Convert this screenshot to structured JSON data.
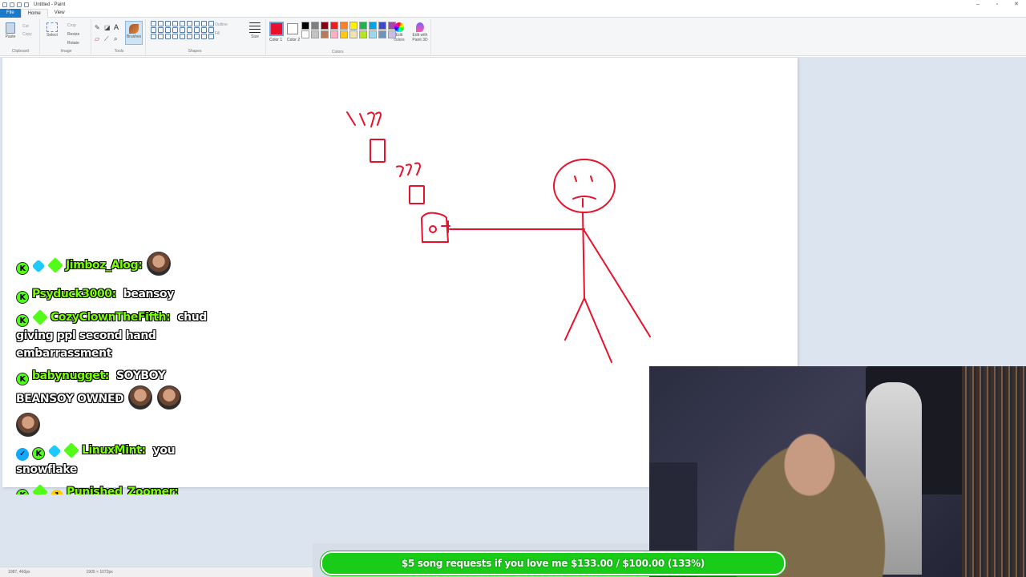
{
  "window": {
    "title": "Untitled - Paint"
  },
  "menu": {
    "tabs": [
      "File",
      "Home",
      "View"
    ]
  },
  "ribbon": {
    "clipboard": {
      "paste": "Paste",
      "cut": "Cut",
      "copy": "Copy",
      "label": "Clipboard"
    },
    "image": {
      "select": "Select",
      "crop": "Crop",
      "resize": "Resize",
      "rotate": "Rotate",
      "label": "Image"
    },
    "tools": {
      "label": "Tools",
      "brushes": "Brushes"
    },
    "shapes": {
      "outline": "Outline",
      "fill": "Fill",
      "label": "Shapes"
    },
    "size": "Size",
    "color1": "Color 1",
    "color2": "Color 2",
    "colors_label": "Colors",
    "edit_colors": "Edit colors",
    "edit_paint3d": "Edit with Paint 3D",
    "active_color": "#e8102a",
    "palette": [
      "#000000",
      "#7f7f7f",
      "#880015",
      "#ed1c24",
      "#ff7f27",
      "#fff200",
      "#22b14c",
      "#00a2e8",
      "#3f48cc",
      "#a349a4",
      "#ffffff",
      "#c3c3c3",
      "#b97a57",
      "#ffaec9",
      "#ffc90e",
      "#efe4b0",
      "#b5e61d",
      "#99d9ea",
      "#7092be",
      "#c8bfe7"
    ]
  },
  "status": {
    "cursor": "1087, 460px",
    "size": "1905 × 1072px"
  },
  "drawing": {
    "stroke_color": "#e8102a"
  },
  "chat": [
    {
      "name": "Jimboz_Alog:",
      "text": "",
      "badges": [
        "k",
        "gem",
        "diamond"
      ],
      "emotes": 1
    },
    {
      "name": "Psyduck3000:",
      "text": "beansoy",
      "badges": [
        "k"
      ],
      "emotes": 0
    },
    {
      "name": "CozyClownTheFifth:",
      "text": "chud giving ppl second hand embarrassment",
      "badges": [
        "k",
        "diamond"
      ],
      "emotes": 0
    },
    {
      "name": "babynugget:",
      "text": "SOYBOY BEANSOY OWNED",
      "badges": [
        "k"
      ],
      "emotes": 3
    },
    {
      "name": "LinuxMint:",
      "text": "you snowflake",
      "badges": [
        "check",
        "k",
        "gem",
        "diamond"
      ],
      "emotes": 0
    },
    {
      "name": "Punished_Zoomer:",
      "text": "",
      "badges": [
        "k",
        "diamond",
        "one"
      ],
      "emotes": 0
    }
  ],
  "goal": {
    "text": "$5 song requests if you love me $133.00 / $100.00 (133%)",
    "progress": 1.0
  }
}
